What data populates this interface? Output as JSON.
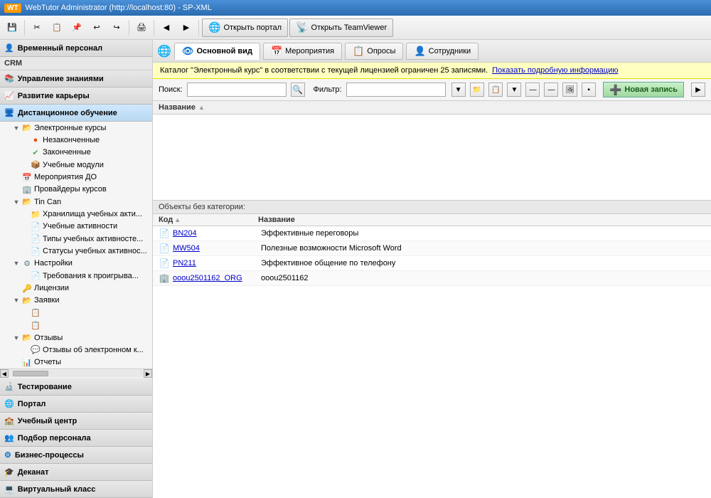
{
  "titlebar": {
    "icon": "WT",
    "title": "WebTutor Administrator (http://localhost:80) - SP-XML"
  },
  "toolbar": {
    "buttons": [
      "save",
      "cut",
      "copy",
      "paste",
      "undo",
      "redo",
      "print",
      "back",
      "forward"
    ],
    "portal_btn": "Открыть портал",
    "teamviewer_btn": "Открыть TeamViewer"
  },
  "sidebar": {
    "sections": [
      {
        "id": "temp-staff",
        "label": "Временный персонал",
        "icon": "person"
      },
      {
        "id": "crm",
        "label": "CRM",
        "type": "group-label"
      },
      {
        "id": "knowledge",
        "label": "Управление знаниями",
        "icon": "book"
      },
      {
        "id": "career",
        "label": "Развитие карьеры",
        "icon": "career"
      },
      {
        "id": "distance",
        "label": "Дистанционное обучение",
        "icon": "distance",
        "expanded": true
      },
      {
        "id": "testing",
        "label": "Тестирование",
        "icon": "test"
      },
      {
        "id": "portal",
        "label": "Портал",
        "icon": "portal"
      },
      {
        "id": "edu-center",
        "label": "Учебный центр",
        "icon": "edu"
      },
      {
        "id": "recruitment",
        "label": "Подбор персонала",
        "icon": "recruit"
      },
      {
        "id": "biz-proc",
        "label": "Бизнес-процессы",
        "icon": "biz"
      },
      {
        "id": "dean",
        "label": "Деканат",
        "icon": "dean"
      },
      {
        "id": "virtual",
        "label": "Виртуальный класс",
        "icon": "virtual"
      }
    ],
    "tree": [
      {
        "id": "e-courses",
        "label": "Электронные курсы",
        "indent": 1,
        "expand": true,
        "icon": "folder-open"
      },
      {
        "id": "unfinished",
        "label": "Незаконченные",
        "indent": 2,
        "icon": "circle-orange"
      },
      {
        "id": "finished",
        "label": "Законченные",
        "indent": 2,
        "icon": "check-green"
      },
      {
        "id": "edu-modules",
        "label": "Учебные модули",
        "indent": 2,
        "icon": "module"
      },
      {
        "id": "events-do",
        "label": "Мероприятия ДО",
        "indent": 1,
        "icon": "event"
      },
      {
        "id": "course-providers",
        "label": "Провайдеры курсов",
        "indent": 1,
        "icon": "provider"
      },
      {
        "id": "tin-can",
        "label": "Tin Can",
        "indent": 1,
        "expand": true,
        "icon": "folder-open"
      },
      {
        "id": "storage",
        "label": "Хранилища учебных акти...",
        "indent": 2,
        "icon": "storage"
      },
      {
        "id": "activities",
        "label": "Учебные активности",
        "indent": 2,
        "icon": "activity"
      },
      {
        "id": "activity-types",
        "label": "Типы учебных активносте...",
        "indent": 2,
        "icon": "type"
      },
      {
        "id": "activity-status",
        "label": "Статусы учебных активнос...",
        "indent": 2,
        "icon": "status"
      },
      {
        "id": "settings",
        "label": "Настройки",
        "indent": 1,
        "expand": true,
        "icon": "gear-folder"
      },
      {
        "id": "requirements",
        "label": "Требования к проигрыва...",
        "indent": 2,
        "icon": "req"
      },
      {
        "id": "licenses",
        "label": "Лицензии",
        "indent": 1,
        "icon": "license"
      },
      {
        "id": "orders",
        "label": "Заявки",
        "indent": 1,
        "expand": true,
        "icon": "folder-orders"
      },
      {
        "id": "order1",
        "label": "",
        "indent": 2,
        "icon": "order-item"
      },
      {
        "id": "order2",
        "label": "",
        "indent": 2,
        "icon": "order-item2"
      },
      {
        "id": "reviews",
        "label": "Отзывы",
        "indent": 1,
        "expand": true,
        "icon": "folder-reviews"
      },
      {
        "id": "e-review",
        "label": "Отзывы об электронном к...",
        "indent": 2,
        "icon": "review-item"
      },
      {
        "id": "reports",
        "label": "Отчеты",
        "indent": 1,
        "icon": "reports"
      }
    ]
  },
  "nav_tabs": [
    {
      "id": "main-view",
      "label": "Основной вид",
      "icon": "eye",
      "active": true
    },
    {
      "id": "events",
      "label": "Мероприятия",
      "icon": "calendar"
    },
    {
      "id": "polls",
      "label": "Опросы",
      "icon": "poll"
    },
    {
      "id": "employees",
      "label": "Сотрудники",
      "icon": "person"
    }
  ],
  "warning": {
    "text": "Каталог \"Электронный курс\" в соответствии с текущей лицензией ограничен 25 записями.",
    "link_text": "Показать подробную информацию"
  },
  "search": {
    "search_label": "Поиск:",
    "search_placeholder": "",
    "filter_label": "Фильтр:",
    "filter_placeholder": "",
    "new_record_label": "Новая запись"
  },
  "col_header": {
    "name_label": "Название",
    "sort_icon": "▲"
  },
  "object_group": {
    "header": "Объекты без категории:",
    "code_label": "Код",
    "name_label": "Название",
    "sort_icon": "▲",
    "rows": [
      {
        "id": "bn204",
        "code": "BN204",
        "name": "Эффективные переговоры",
        "icon": "course"
      },
      {
        "id": "mw504",
        "code": "MW504",
        "name": "Полезные возможности Microsoft Word",
        "icon": "course"
      },
      {
        "id": "pn211",
        "code": "PN211",
        "name": "Эффективное общение по телефону",
        "icon": "course"
      },
      {
        "id": "ooou",
        "code": "ooou2501162_ORG",
        "name": "ooou2501162",
        "icon": "org"
      }
    ]
  },
  "colors": {
    "accent_blue": "#0078d7",
    "warning_bg": "#ffffc0",
    "sidebar_bg": "#f5f5f5",
    "tree_selected": "#0078d7",
    "link_color": "#0000cc"
  }
}
